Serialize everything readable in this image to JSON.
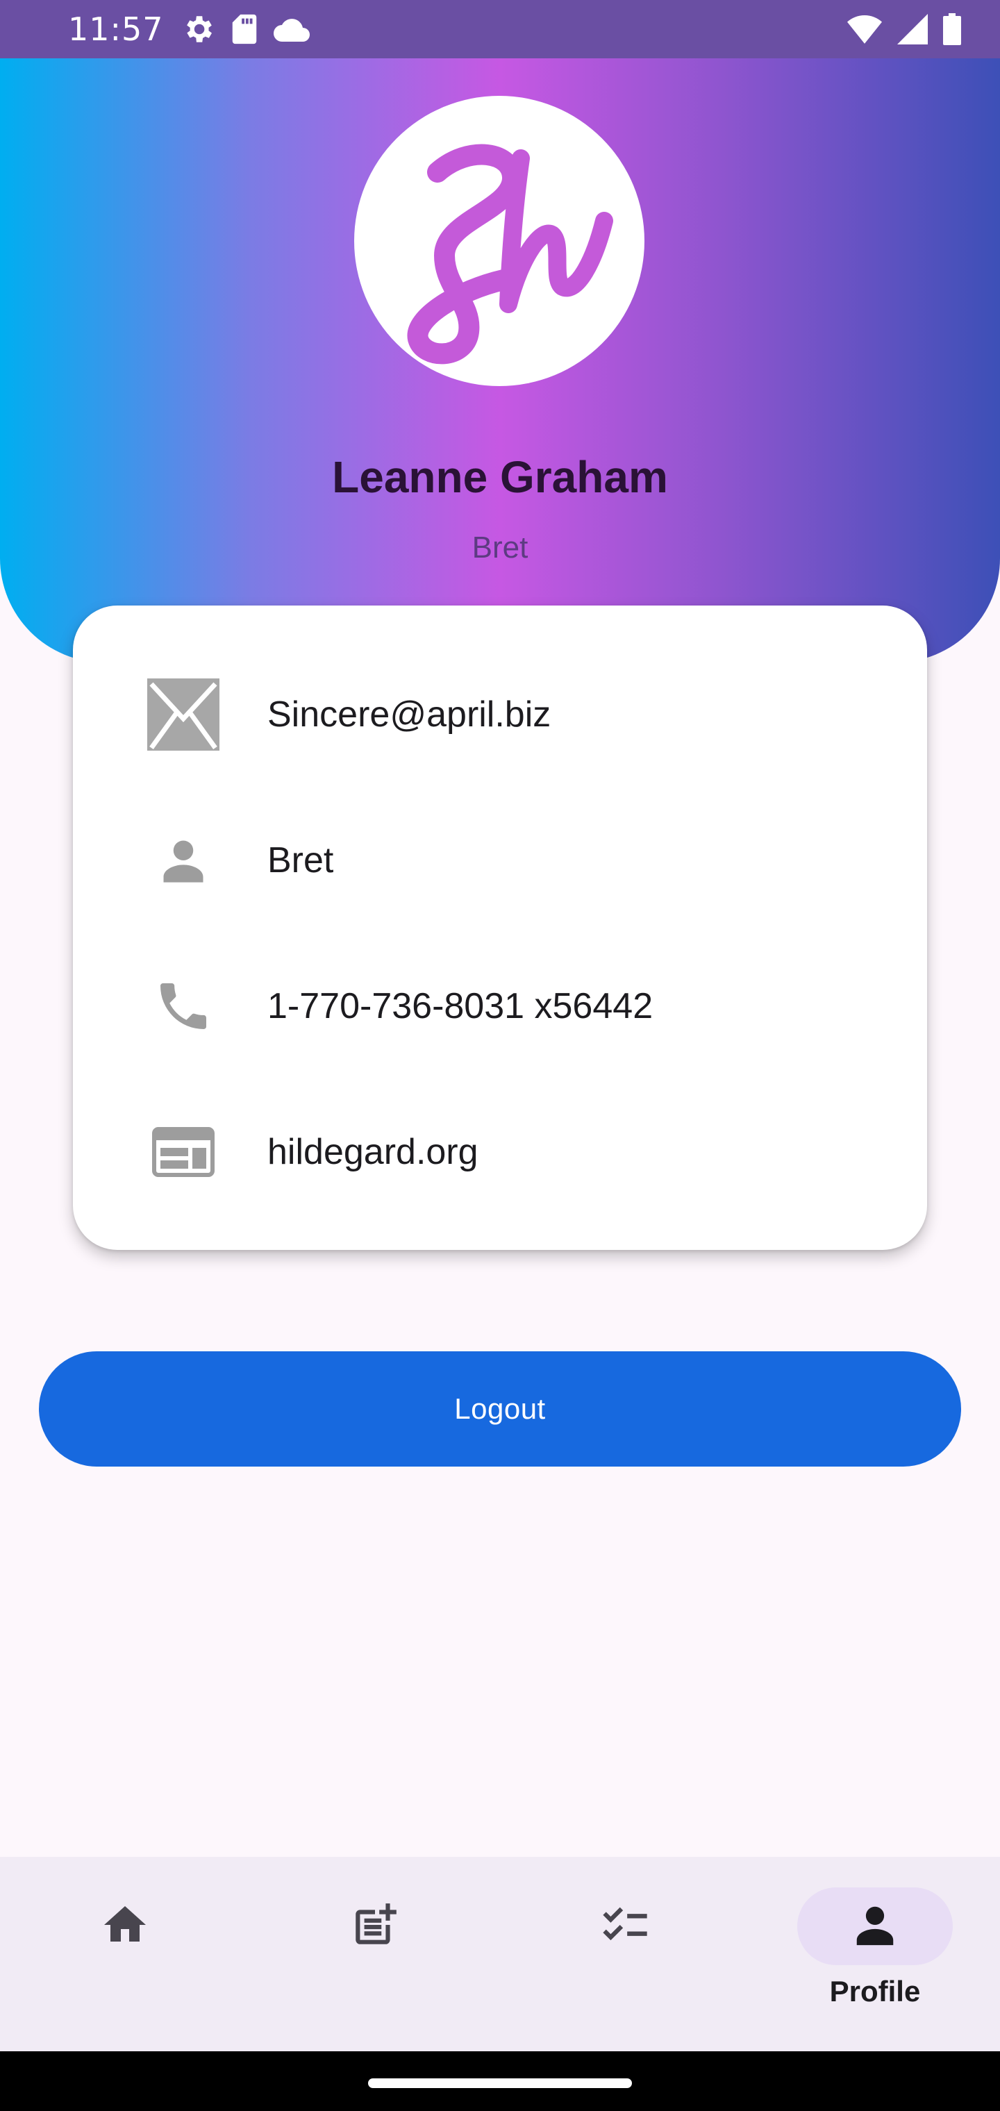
{
  "status_bar": {
    "time": "11:57",
    "left_icons": [
      "settings-icon",
      "sd-card-icon",
      "cloud-icon"
    ],
    "right_icons": [
      "wifi-icon",
      "signal-icon",
      "battery-icon"
    ]
  },
  "profile": {
    "logo_text": "Sh",
    "name": "Leanne Graham",
    "username": "Bret"
  },
  "info": [
    {
      "icon": "email-icon",
      "value": "Sincere@april.biz"
    },
    {
      "icon": "person-icon",
      "value": "Bret"
    },
    {
      "icon": "phone-icon",
      "value": "1-770-736-8031 x56442"
    },
    {
      "icon": "website-icon",
      "value": "hildegard.org"
    }
  ],
  "logout_label": "Logout",
  "bottom_nav": {
    "items": [
      {
        "icon": "home-icon",
        "label": ""
      },
      {
        "icon": "post-add-icon",
        "label": ""
      },
      {
        "icon": "checklist-icon",
        "label": ""
      },
      {
        "icon": "profile-icon",
        "label": "Profile",
        "active": true
      }
    ]
  },
  "colors": {
    "status_bar": "#6a4fa3",
    "button": "#1769df",
    "nav_background": "#f1ebf5",
    "nav_active_pill": "#e8ddf5",
    "name_text": "#2a1236"
  }
}
